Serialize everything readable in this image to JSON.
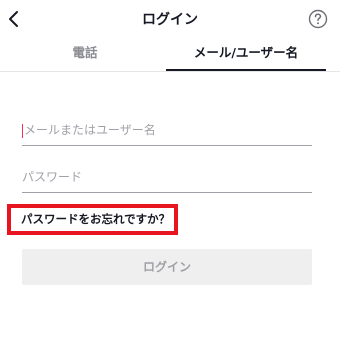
{
  "header": {
    "title": "ログイン",
    "back_icon": "chevron-left-icon",
    "help_icon": "question-circle-icon"
  },
  "tabs": [
    {
      "label": "電話",
      "active": false
    },
    {
      "label": "メール/ユーザー名",
      "active": true
    }
  ],
  "form": {
    "email_placeholder": "メールまたはユーザー名",
    "email_value": "",
    "password_placeholder": "パスワード",
    "password_value": "",
    "forgot_password_label": "パスワードをお忘れですか？",
    "login_label": "ログイン"
  },
  "colors": {
    "highlight_border": "#e8141f",
    "caret": "#fe2c55",
    "button_disabled_bg": "#efeff0",
    "button_disabled_text": "#9fa0a6"
  }
}
